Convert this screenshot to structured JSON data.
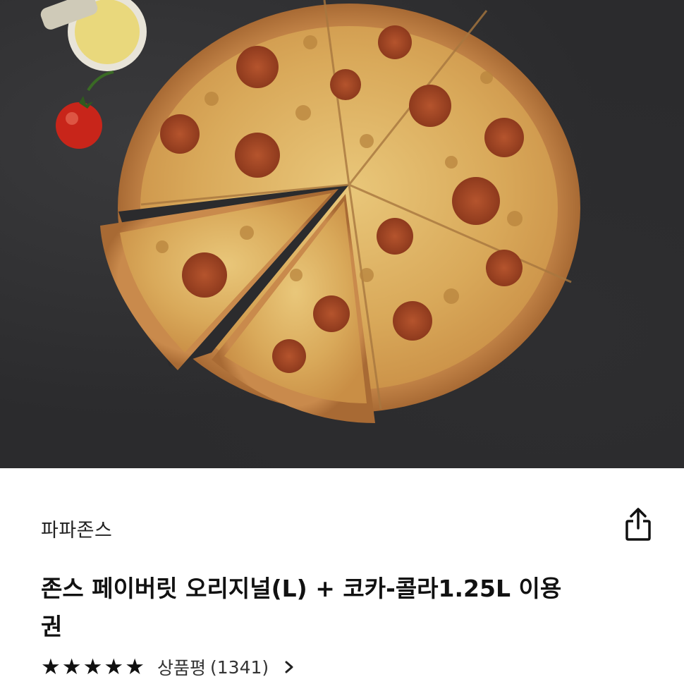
{
  "hero": {
    "alt": "파파존스 피자 이미지"
  },
  "product": {
    "brand": "파파존스",
    "title": "존스 페이버릿 오리지널(L) + 코카-콜라1.25L 이용권",
    "rating": {
      "stars": 5,
      "label": "상품평",
      "count": "(1341)"
    }
  },
  "icons": {
    "share": "share-icon",
    "star": "star-icon",
    "chevron": "chevron-right-icon"
  },
  "colors": {
    "background": "#ffffff",
    "text": "#111111",
    "hero_bg": "#2b2b2d"
  }
}
